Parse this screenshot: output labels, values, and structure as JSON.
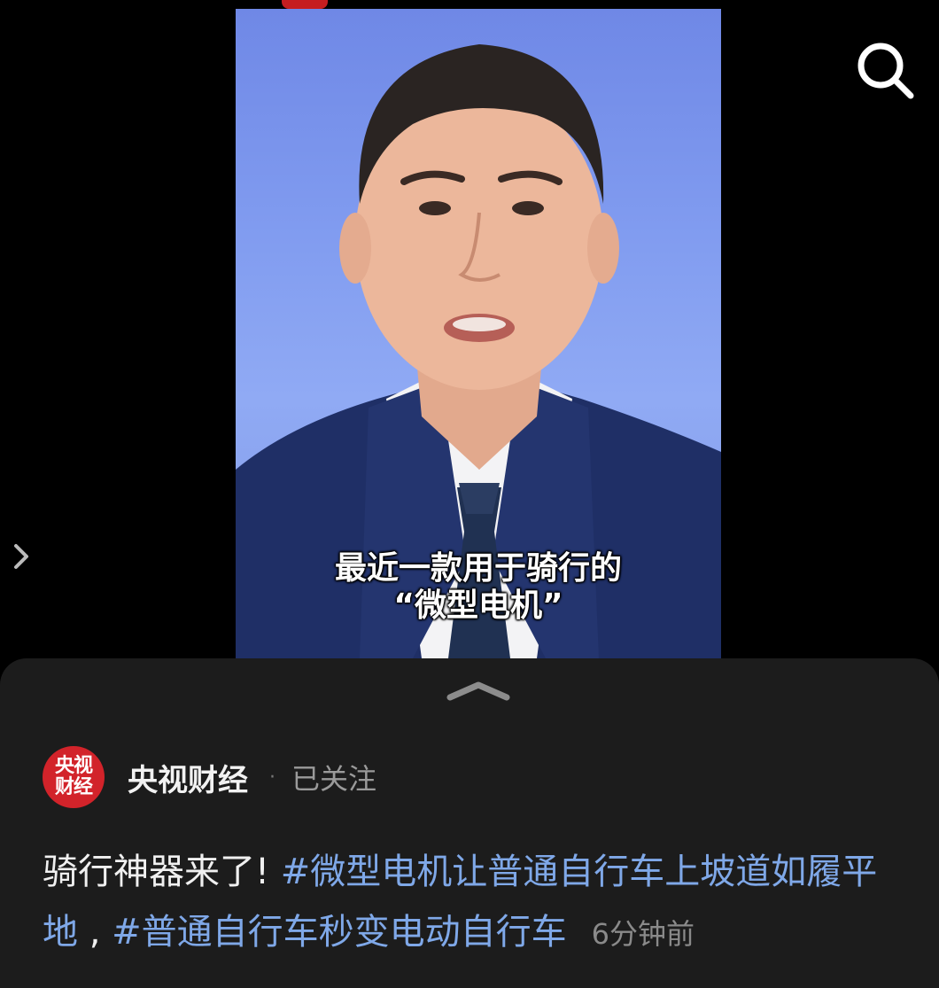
{
  "video": {
    "subtitle_line1": "最近一款用于骑行的",
    "subtitle_line2": "“微型电机”"
  },
  "toolbar": {
    "search_icon": "search-icon"
  },
  "side_nav": {
    "icon": "chevron-right-icon"
  },
  "sheet": {
    "handle_icon": "chevron-up-icon",
    "author": {
      "avatar_line1": "央视",
      "avatar_line2": "财经",
      "name": "央视财经",
      "separator": "·",
      "follow_status": "已关注"
    },
    "caption": {
      "text": "骑行神器来了! ",
      "hashtag1": "#微型电机让普通自行车上坡道如履平地",
      "sep": " , ",
      "hashtag2": "#普通自行车秒变电动自行车",
      "time": "6分钟前"
    }
  },
  "colors": {
    "hashtag": "#7fa8e8",
    "avatar": "#d2232a",
    "sheet_bg": "#1c1c1c"
  }
}
